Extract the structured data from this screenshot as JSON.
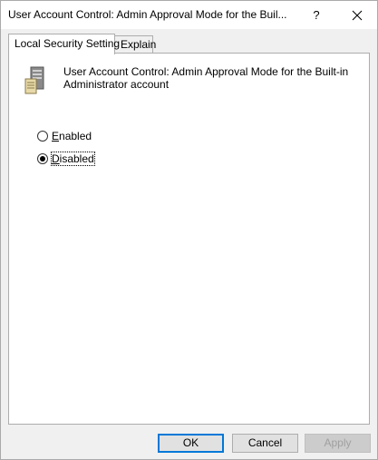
{
  "window": {
    "title": "User Account Control: Admin Approval Mode for the Buil...",
    "help_label": "?"
  },
  "tabs": [
    {
      "label": "Local Security Setting",
      "active": true
    },
    {
      "label": "Explain",
      "active": false
    }
  ],
  "policy": {
    "icon": "server-policy-icon",
    "line1": "User Account Control: Admin Approval Mode for the Built-in",
    "line2": "Administrator account"
  },
  "options": [
    {
      "label": "Enabled",
      "mnemonic": "E",
      "rest": "nabled",
      "checked": false
    },
    {
      "label": "Disabled",
      "mnemonic": "D",
      "rest": "isabled",
      "checked": true
    }
  ],
  "buttons": {
    "ok": "OK",
    "cancel": "Cancel",
    "apply": "Apply"
  },
  "colors": {
    "focus_accent": "#0078d7"
  }
}
